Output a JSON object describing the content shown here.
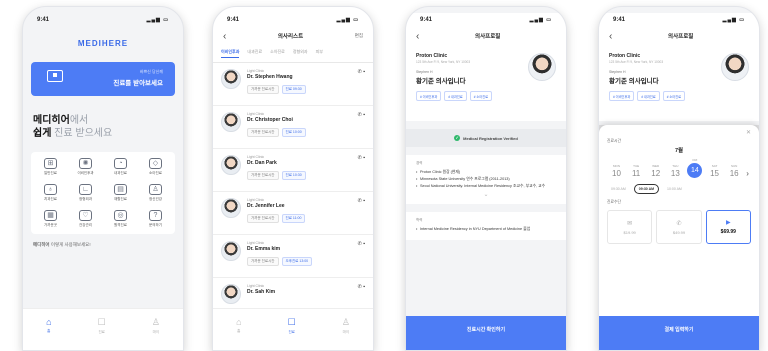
{
  "colors": {
    "accent": "#4d7cf5",
    "brand": "#3b6be8",
    "verified": "#2fb86b"
  },
  "status_time": "9:41",
  "screen1": {
    "brand": "MEDIHERE",
    "banner_small": "바쁘신 당신께",
    "banner_main": "진료를 받아보세요",
    "headline_bold": "메디히어",
    "headline_rest": "에서",
    "headline_line2_bold": "쉽게",
    "headline_line2_rest": " 진료 받으세요",
    "grid": [
      {
        "icon": "clinic-icon",
        "glyph": "⊞",
        "label": "일반진료"
      },
      {
        "icon": "virus-icon",
        "glyph": "✺",
        "label": "이비인후과"
      },
      {
        "icon": "stomach-icon",
        "glyph": "◔",
        "label": "내과진료"
      },
      {
        "icon": "pill-icon",
        "glyph": "◇",
        "label": "소아진료"
      },
      {
        "icon": "tooth-icon",
        "glyph": "♁",
        "label": "치과진료"
      },
      {
        "icon": "leg-icon",
        "glyph": "∟",
        "label": "정형외과"
      },
      {
        "icon": "bed-icon",
        "glyph": "▤",
        "label": "재활진료"
      },
      {
        "icon": "person-icon",
        "glyph": "♙",
        "label": "정신건강"
      },
      {
        "icon": "building-icon",
        "glyph": "▦",
        "label": "가까운곳"
      },
      {
        "icon": "heart-icon",
        "glyph": "♡",
        "label": "건강관리"
      },
      {
        "icon": "camera-icon",
        "glyph": "◎",
        "label": "원격진료"
      },
      {
        "icon": "question-icon",
        "glyph": "?",
        "label": "문의하기"
      }
    ],
    "footer_bold": "메디히어",
    "footer_rest": " 이렇게 사용해보세요!",
    "tabs": [
      {
        "glyph": "⌂",
        "label": "홈"
      },
      {
        "glyph": "☐",
        "label": "진료"
      },
      {
        "glyph": "♙",
        "label": "마이"
      }
    ]
  },
  "screen2": {
    "title": "의사리스트",
    "right": "편집",
    "tabs": [
      "이비인후과",
      "내과진료",
      "소아진료",
      "정형외과",
      "피부"
    ],
    "doctors": [
      {
        "clinic": "Light Clinic",
        "name": "Dr. Stephen Hwang",
        "chip1": "가까운 진료시간",
        "chip2": "진료 09:30"
      },
      {
        "clinic": "Light Clinic",
        "name": "Dr. Christoper Choi",
        "chip1": "가까운 진료시간",
        "chip2": "진료 10:00"
      },
      {
        "clinic": "Light Clinic",
        "name": "Dr. Dan Park",
        "chip1": "가까운 진료시간",
        "chip2": "진료 10:30"
      },
      {
        "clinic": "Light Clinic",
        "name": "Dr. Jennifer Lee",
        "chip1": "가까운 진료시간",
        "chip2": "진료 11:00"
      },
      {
        "clinic": "Light Clinic",
        "name": "Dr. Emma kim",
        "chip1": "가까운 진료시간",
        "chip2": "오후진료 13:00"
      },
      {
        "clinic": "Light Clinic",
        "name": "Dr. Sah Kim",
        "chip1": "",
        "chip2": ""
      }
    ],
    "tabbar": [
      {
        "glyph": "⌂",
        "label": "홈"
      },
      {
        "glyph": "☐",
        "label": "진료"
      },
      {
        "glyph": "♙",
        "label": "마이"
      }
    ]
  },
  "screen3": {
    "title": "의사프로필",
    "clinic": "Proton Clinic",
    "address": "123 5th Ave Fl 9, New York, NY 10003",
    "doctor_en": "Stephen H",
    "doctor_ko": "황기준 의사입니다",
    "tags": [
      "# 이비인후과",
      "# 내과진료",
      "# 소아진료"
    ],
    "verified": "Medical Registration Verified",
    "career_label": "경력",
    "career": [
      "Proton Clinic 원장 (현재)",
      "Minnesota State University 연수 프로그램 (2011-2013)",
      "Seoul National University. Internal Medicine Residency 조교수, 부교수, 교수"
    ],
    "edu_label": "학력",
    "education": [
      "Internal Medicine Residency in NYU Department of Medicine 졸업"
    ],
    "cta": "진료시간 확인하기"
  },
  "screen4": {
    "title": "의사프로필",
    "clinic": "Proton Clinic",
    "address": "123 5th Ave Fl 9, New York, NY 10003",
    "doctor_en": "Stephen H",
    "doctor_ko": "황기준 의사입니다",
    "tags": [
      "# 이비인후과",
      "# 내과진료",
      "# 소아진료"
    ],
    "date_label": "진료시간",
    "month": "7월",
    "days": [
      {
        "dow": "MON",
        "num": "10"
      },
      {
        "dow": "TUE",
        "num": "11"
      },
      {
        "dow": "WED",
        "num": "12"
      },
      {
        "dow": "THU",
        "num": "13"
      },
      {
        "dow": "FRI",
        "num": "14"
      },
      {
        "dow": "SAT",
        "num": "15"
      },
      {
        "dow": "SUN",
        "num": "16"
      }
    ],
    "times": [
      "09:30 AM",
      "09:30 AM",
      "10:00 AM"
    ],
    "price_label": "진료수단",
    "prices": [
      {
        "glyph": "✉",
        "value": "$19.99"
      },
      {
        "glyph": "✆",
        "value": "$49.99"
      },
      {
        "glyph": "▶",
        "value": "$69.99"
      }
    ],
    "cta": "결제 입력하기"
  }
}
